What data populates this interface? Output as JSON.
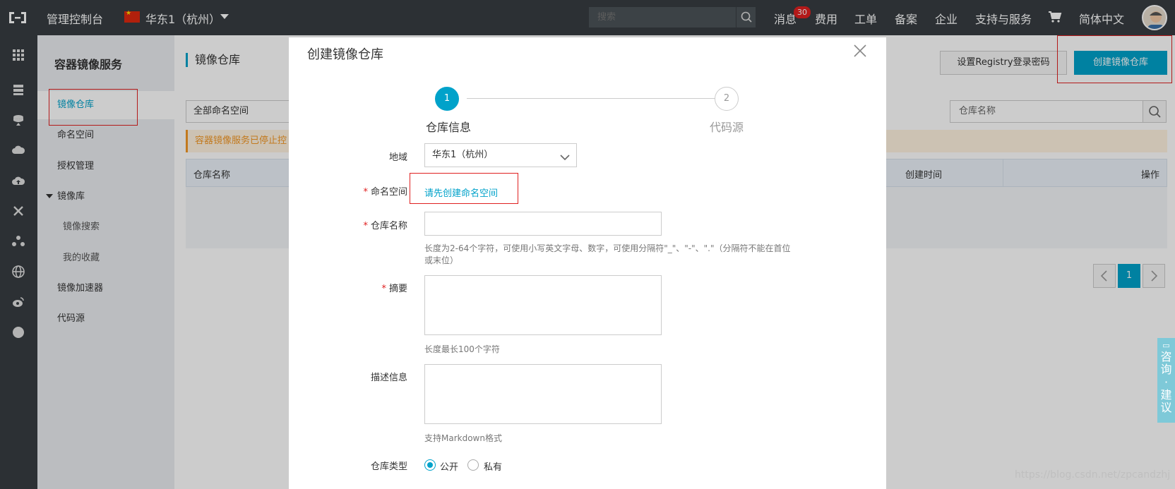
{
  "topbar": {
    "console_label": "管理控制台",
    "region_label": "华东1（杭州）",
    "search_placeholder": "搜索",
    "nav": [
      "消息",
      "费用",
      "工单",
      "备案",
      "企业",
      "支持与服务",
      "简体中文"
    ],
    "message_badge": "30"
  },
  "sidebar": {
    "title": "容器镜像服务",
    "items": [
      {
        "label": "镜像仓库"
      },
      {
        "label": "命名空间"
      },
      {
        "label": "授权管理"
      },
      {
        "label": "镜像库"
      },
      {
        "label": "镜像搜索"
      },
      {
        "label": "我的收藏"
      },
      {
        "label": "镜像加速器"
      },
      {
        "label": "代码源"
      }
    ]
  },
  "main": {
    "page_title": "镜像仓库",
    "btn_set_password": "设置Registry登录密码",
    "btn_create": "创建镜像仓库",
    "namespace_filter": "全部命名空间",
    "repo_search_placeholder": "仓库名称",
    "notice": "容器镜像服务已停止控",
    "columns": [
      "仓库名称",
      "创建时间",
      "操作"
    ],
    "pagination": {
      "current": "1"
    }
  },
  "modal": {
    "title": "创建镜像仓库",
    "steps": [
      {
        "number": "1",
        "label": "仓库信息"
      },
      {
        "number": "2",
        "label": "代码源"
      }
    ],
    "fields": {
      "region_label": "地域",
      "region_value": "华东1（杭州）",
      "namespace_label": "命名空间",
      "namespace_link": "请先创建命名空间",
      "repo_name_label": "仓库名称",
      "repo_name_hint_1": "长度为2-64个字符，可使用小写英文字母、数字，可使用分隔符\"_\"、\"-\"、\".\"（分隔符不能在首位",
      "repo_name_hint_2": "或末位）",
      "summary_label": "摘要",
      "summary_hint": "长度最长100个字符",
      "description_label": "描述信息",
      "description_hint": "支持Markdown格式",
      "repo_type_label": "仓库类型",
      "repo_type_options": [
        "公开",
        "私有"
      ],
      "repo_type_selected": "公开",
      "required_mark": "*"
    }
  },
  "consult_widget": {
    "chars": [
      "咨",
      "询",
      "·",
      "建",
      "议"
    ]
  },
  "watermark": "https://blog.csdn.net/zpcandzhj",
  "colors": {
    "accent": "#00a2ca",
    "topbar": "#373d41",
    "highlight": "#e02020"
  }
}
